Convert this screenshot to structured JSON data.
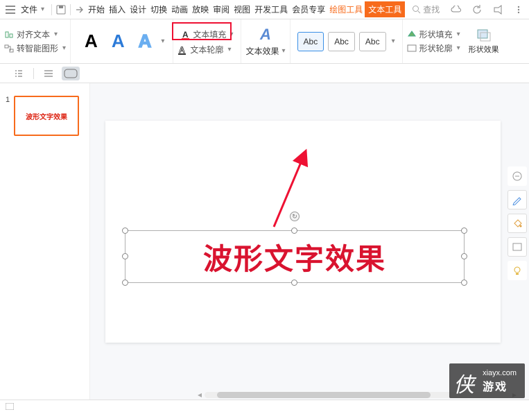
{
  "titlebar": {
    "menu_label": "文件",
    "tabs": [
      "开始",
      "插入",
      "设计",
      "切换",
      "动画",
      "放映",
      "审阅",
      "视图",
      "开发工具",
      "会员专享",
      "绘图工具",
      "文本工具"
    ],
    "search_placeholder": "查找"
  },
  "ribbon": {
    "align_text": "对齐文本",
    "convert_smart": "转智能图形",
    "text_fill": "文本填充",
    "text_outline": "文本轮廓",
    "text_effect": "文本效果",
    "abc": "Abc",
    "shape_fill": "形状填充",
    "shape_outline": "形状轮廓",
    "shape_effect": "形状效果"
  },
  "thumb": {
    "num": "1",
    "label": "波形文字效果"
  },
  "slide": {
    "text": "波形文字效果"
  },
  "watermark": {
    "char": "侠",
    "domain": "xiayx.com",
    "sub": "游戏"
  },
  "status": {
    "left": ""
  }
}
